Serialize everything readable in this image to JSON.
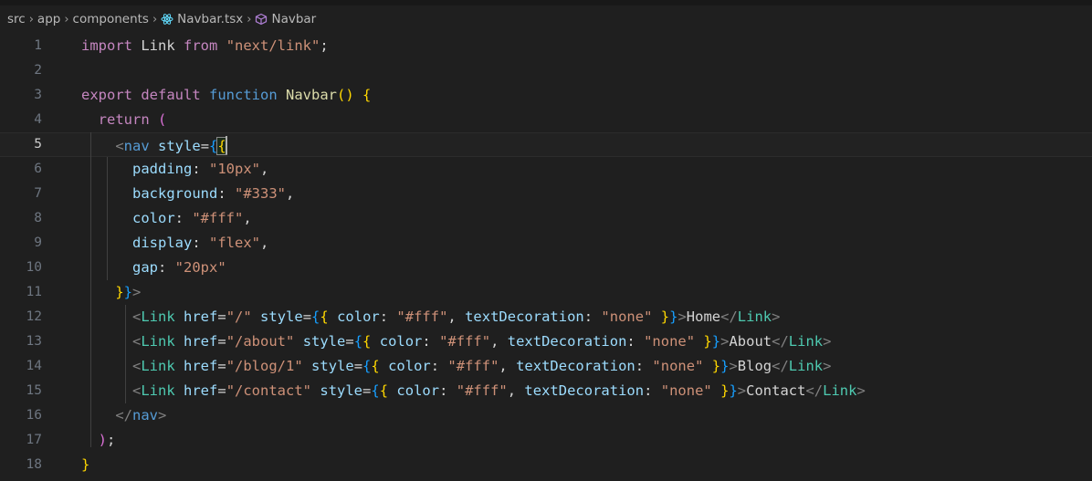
{
  "breadcrumb": {
    "items": [
      "src",
      "app",
      "components",
      "Navbar.tsx",
      "Navbar"
    ],
    "separator": "›"
  },
  "editor": {
    "active_line": 5,
    "lines": [
      {
        "n": "1",
        "tokens": [
          [
            "kw2",
            "import"
          ],
          [
            "plain",
            " "
          ],
          [
            "plain",
            "Link"
          ],
          [
            "plain",
            " "
          ],
          [
            "kw2",
            "from"
          ],
          [
            "plain",
            " "
          ],
          [
            "str",
            "\"next/link\""
          ],
          [
            "plain",
            ";"
          ]
        ]
      },
      {
        "n": "2",
        "tokens": []
      },
      {
        "n": "3",
        "tokens": [
          [
            "kw2",
            "export"
          ],
          [
            "plain",
            " "
          ],
          [
            "kw2",
            "default"
          ],
          [
            "plain",
            " "
          ],
          [
            "kw",
            "function"
          ],
          [
            "plain",
            " "
          ],
          [
            "fn",
            "Navbar"
          ],
          [
            "br1",
            "()"
          ],
          [
            "plain",
            " "
          ],
          [
            "br1",
            "{"
          ]
        ]
      },
      {
        "n": "4",
        "indent": "  ",
        "tokens": [
          [
            "kw2",
            "return"
          ],
          [
            "plain",
            " "
          ],
          [
            "br2",
            "("
          ]
        ]
      },
      {
        "n": "5",
        "indent": "    ",
        "tokens": [
          [
            "tagb",
            "<"
          ],
          [
            "tag",
            "nav"
          ],
          [
            "plain",
            " "
          ],
          [
            "prop",
            "style"
          ],
          [
            "plain",
            "="
          ],
          [
            "br3",
            "{"
          ],
          [
            "br1bm",
            "{"
          ]
        ]
      },
      {
        "n": "6",
        "indent": "      ",
        "tokens": [
          [
            "prop",
            "padding"
          ],
          [
            "plain",
            ": "
          ],
          [
            "str",
            "\"10px\""
          ],
          [
            "plain",
            ","
          ]
        ]
      },
      {
        "n": "7",
        "indent": "      ",
        "tokens": [
          [
            "prop",
            "background"
          ],
          [
            "plain",
            ": "
          ],
          [
            "str",
            "\"#333\""
          ],
          [
            "plain",
            ","
          ]
        ]
      },
      {
        "n": "8",
        "indent": "      ",
        "tokens": [
          [
            "prop",
            "color"
          ],
          [
            "plain",
            ": "
          ],
          [
            "str",
            "\"#fff\""
          ],
          [
            "plain",
            ","
          ]
        ]
      },
      {
        "n": "9",
        "indent": "      ",
        "tokens": [
          [
            "prop",
            "display"
          ],
          [
            "plain",
            ": "
          ],
          [
            "str",
            "\"flex\""
          ],
          [
            "plain",
            ","
          ]
        ]
      },
      {
        "n": "10",
        "indent": "      ",
        "tokens": [
          [
            "prop",
            "gap"
          ],
          [
            "plain",
            ": "
          ],
          [
            "str",
            "\"20px\""
          ]
        ]
      },
      {
        "n": "11",
        "indent": "    ",
        "tokens": [
          [
            "br1",
            "}"
          ],
          [
            "br3",
            "}"
          ],
          [
            "tagb",
            ">"
          ]
        ]
      },
      {
        "n": "12",
        "indent": "      ",
        "tokens": [
          [
            "tagb",
            "<"
          ],
          [
            "comp",
            "Link"
          ],
          [
            "plain",
            " "
          ],
          [
            "prop",
            "href"
          ],
          [
            "plain",
            "="
          ],
          [
            "str",
            "\"/\""
          ],
          [
            "plain",
            " "
          ],
          [
            "prop",
            "style"
          ],
          [
            "plain",
            "="
          ],
          [
            "br3",
            "{"
          ],
          [
            "br1",
            "{"
          ],
          [
            "plain",
            " "
          ],
          [
            "prop",
            "color"
          ],
          [
            "plain",
            ": "
          ],
          [
            "str",
            "\"#fff\""
          ],
          [
            "plain",
            ", "
          ],
          [
            "prop",
            "textDecoration"
          ],
          [
            "plain",
            ": "
          ],
          [
            "str",
            "\"none\""
          ],
          [
            "plain",
            " "
          ],
          [
            "br1",
            "}"
          ],
          [
            "br3",
            "}"
          ],
          [
            "tagb",
            ">"
          ],
          [
            "plain",
            "Home"
          ],
          [
            "tagb",
            "</"
          ],
          [
            "comp",
            "Link"
          ],
          [
            "tagb",
            ">"
          ]
        ]
      },
      {
        "n": "13",
        "indent": "      ",
        "tokens": [
          [
            "tagb",
            "<"
          ],
          [
            "comp",
            "Link"
          ],
          [
            "plain",
            " "
          ],
          [
            "prop",
            "href"
          ],
          [
            "plain",
            "="
          ],
          [
            "str",
            "\"/about\""
          ],
          [
            "plain",
            " "
          ],
          [
            "prop",
            "style"
          ],
          [
            "plain",
            "="
          ],
          [
            "br3",
            "{"
          ],
          [
            "br1",
            "{"
          ],
          [
            "plain",
            " "
          ],
          [
            "prop",
            "color"
          ],
          [
            "plain",
            ": "
          ],
          [
            "str",
            "\"#fff\""
          ],
          [
            "plain",
            ", "
          ],
          [
            "prop",
            "textDecoration"
          ],
          [
            "plain",
            ": "
          ],
          [
            "str",
            "\"none\""
          ],
          [
            "plain",
            " "
          ],
          [
            "br1",
            "}"
          ],
          [
            "br3",
            "}"
          ],
          [
            "tagb",
            ">"
          ],
          [
            "plain",
            "About"
          ],
          [
            "tagb",
            "</"
          ],
          [
            "comp",
            "Link"
          ],
          [
            "tagb",
            ">"
          ]
        ]
      },
      {
        "n": "14",
        "indent": "      ",
        "tokens": [
          [
            "tagb",
            "<"
          ],
          [
            "comp",
            "Link"
          ],
          [
            "plain",
            " "
          ],
          [
            "prop",
            "href"
          ],
          [
            "plain",
            "="
          ],
          [
            "str",
            "\"/blog/1\""
          ],
          [
            "plain",
            " "
          ],
          [
            "prop",
            "style"
          ],
          [
            "plain",
            "="
          ],
          [
            "br3",
            "{"
          ],
          [
            "br1",
            "{"
          ],
          [
            "plain",
            " "
          ],
          [
            "prop",
            "color"
          ],
          [
            "plain",
            ": "
          ],
          [
            "str",
            "\"#fff\""
          ],
          [
            "plain",
            ", "
          ],
          [
            "prop",
            "textDecoration"
          ],
          [
            "plain",
            ": "
          ],
          [
            "str",
            "\"none\""
          ],
          [
            "plain",
            " "
          ],
          [
            "br1",
            "}"
          ],
          [
            "br3",
            "}"
          ],
          [
            "tagb",
            ">"
          ],
          [
            "plain",
            "Blog"
          ],
          [
            "tagb",
            "</"
          ],
          [
            "comp",
            "Link"
          ],
          [
            "tagb",
            ">"
          ]
        ]
      },
      {
        "n": "15",
        "indent": "      ",
        "tokens": [
          [
            "tagb",
            "<"
          ],
          [
            "comp",
            "Link"
          ],
          [
            "plain",
            " "
          ],
          [
            "prop",
            "href"
          ],
          [
            "plain",
            "="
          ],
          [
            "str",
            "\"/contact\""
          ],
          [
            "plain",
            " "
          ],
          [
            "prop",
            "style"
          ],
          [
            "plain",
            "="
          ],
          [
            "br3",
            "{"
          ],
          [
            "br1",
            "{"
          ],
          [
            "plain",
            " "
          ],
          [
            "prop",
            "color"
          ],
          [
            "plain",
            ": "
          ],
          [
            "str",
            "\"#fff\""
          ],
          [
            "plain",
            ", "
          ],
          [
            "prop",
            "textDecoration"
          ],
          [
            "plain",
            ": "
          ],
          [
            "str",
            "\"none\""
          ],
          [
            "plain",
            " "
          ],
          [
            "br1",
            "}"
          ],
          [
            "br3",
            "}"
          ],
          [
            "tagb",
            ">"
          ],
          [
            "plain",
            "Contact"
          ],
          [
            "tagb",
            "</"
          ],
          [
            "comp",
            "Link"
          ],
          [
            "tagb",
            ">"
          ]
        ]
      },
      {
        "n": "16",
        "indent": "    ",
        "tokens": [
          [
            "tagb",
            "</"
          ],
          [
            "tag",
            "nav"
          ],
          [
            "tagb",
            ">"
          ]
        ]
      },
      {
        "n": "17",
        "indent": "  ",
        "tokens": [
          [
            "br2",
            ")"
          ],
          [
            "plain",
            ";"
          ]
        ]
      },
      {
        "n": "18",
        "tokens": [
          [
            "br1",
            "}"
          ]
        ]
      }
    ]
  },
  "colors": {
    "background": "#1f1f1f",
    "keyword": "#569cd6",
    "control_keyword": "#c586c0",
    "function": "#dcdcaa",
    "string": "#ce9178",
    "property": "#9cdcfe",
    "component": "#4ec9b0",
    "bracket_gold": "#ffd700",
    "bracket_orchid": "#da70d6",
    "bracket_blue": "#179fff"
  },
  "icons": {
    "file": "react-tsx-file-icon",
    "symbol": "component-symbol-icon"
  }
}
